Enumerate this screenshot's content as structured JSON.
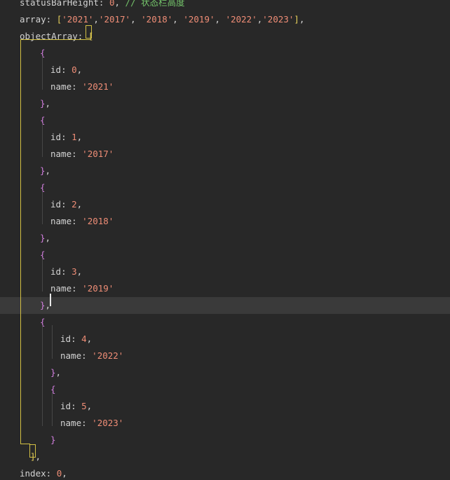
{
  "editor": {
    "lines": [
      {
        "indent": 28,
        "tokens": [
          {
            "t": "prop",
            "v": "statusBarHeight"
          },
          {
            "t": "punc",
            "v": ": "
          },
          {
            "t": "num",
            "v": "0"
          },
          {
            "t": "punc",
            "v": ", "
          },
          {
            "t": "cmt",
            "v": "// 状态栏高度"
          }
        ]
      },
      {
        "indent": 28,
        "tokens": [
          {
            "t": "prop",
            "v": "array"
          },
          {
            "t": "punc",
            "v": ": "
          },
          {
            "t": "brk",
            "v": "["
          },
          {
            "t": "str",
            "v": "'2021'"
          },
          {
            "t": "punc",
            "v": ","
          },
          {
            "t": "str",
            "v": "'2017'"
          },
          {
            "t": "punc",
            "v": ", "
          },
          {
            "t": "str",
            "v": "'2018'"
          },
          {
            "t": "punc",
            "v": ", "
          },
          {
            "t": "str",
            "v": "'2019'"
          },
          {
            "t": "punc",
            "v": ", "
          },
          {
            "t": "str",
            "v": "'2022'"
          },
          {
            "t": "punc",
            "v": ","
          },
          {
            "t": "str",
            "v": "'2023'"
          },
          {
            "t": "brk",
            "v": "]"
          },
          {
            "t": "punc",
            "v": ","
          }
        ]
      },
      {
        "indent": 28,
        "tokens": [
          {
            "t": "prop",
            "v": "objectArray"
          },
          {
            "t": "punc",
            "v": ": "
          },
          {
            "t": "brk",
            "v": "["
          }
        ]
      },
      {
        "indent": 57,
        "tokens": [
          {
            "t": "brace",
            "v": "{"
          }
        ]
      },
      {
        "indent": 72,
        "tokens": [
          {
            "t": "prop",
            "v": "id"
          },
          {
            "t": "punc",
            "v": ": "
          },
          {
            "t": "num",
            "v": "0"
          },
          {
            "t": "punc",
            "v": ","
          }
        ]
      },
      {
        "indent": 72,
        "tokens": [
          {
            "t": "prop",
            "v": "name"
          },
          {
            "t": "punc",
            "v": ": "
          },
          {
            "t": "str",
            "v": "'2021'"
          }
        ]
      },
      {
        "indent": 57,
        "tokens": [
          {
            "t": "brace",
            "v": "}"
          },
          {
            "t": "punc",
            "v": ","
          }
        ]
      },
      {
        "indent": 57,
        "tokens": [
          {
            "t": "brace",
            "v": "{"
          }
        ]
      },
      {
        "indent": 72,
        "tokens": [
          {
            "t": "prop",
            "v": "id"
          },
          {
            "t": "punc",
            "v": ": "
          },
          {
            "t": "num",
            "v": "1"
          },
          {
            "t": "punc",
            "v": ","
          }
        ]
      },
      {
        "indent": 72,
        "tokens": [
          {
            "t": "prop",
            "v": "name"
          },
          {
            "t": "punc",
            "v": ": "
          },
          {
            "t": "str",
            "v": "'2017'"
          }
        ]
      },
      {
        "indent": 57,
        "tokens": [
          {
            "t": "brace",
            "v": "}"
          },
          {
            "t": "punc",
            "v": ","
          }
        ]
      },
      {
        "indent": 57,
        "tokens": [
          {
            "t": "brace",
            "v": "{"
          }
        ]
      },
      {
        "indent": 72,
        "tokens": [
          {
            "t": "prop",
            "v": "id"
          },
          {
            "t": "punc",
            "v": ": "
          },
          {
            "t": "num",
            "v": "2"
          },
          {
            "t": "punc",
            "v": ","
          }
        ]
      },
      {
        "indent": 72,
        "tokens": [
          {
            "t": "prop",
            "v": "name"
          },
          {
            "t": "punc",
            "v": ": "
          },
          {
            "t": "str",
            "v": "'2018'"
          }
        ]
      },
      {
        "indent": 57,
        "tokens": [
          {
            "t": "brace",
            "v": "}"
          },
          {
            "t": "punc",
            "v": ","
          }
        ]
      },
      {
        "indent": 57,
        "tokens": [
          {
            "t": "brace",
            "v": "{"
          }
        ]
      },
      {
        "indent": 72,
        "tokens": [
          {
            "t": "prop",
            "v": "id"
          },
          {
            "t": "punc",
            "v": ": "
          },
          {
            "t": "num",
            "v": "3"
          },
          {
            "t": "punc",
            "v": ","
          }
        ]
      },
      {
        "indent": 72,
        "tokens": [
          {
            "t": "prop",
            "v": "name"
          },
          {
            "t": "punc",
            "v": ": "
          },
          {
            "t": "str",
            "v": "'2019'"
          }
        ]
      },
      {
        "indent": 57,
        "current": true,
        "tokens": [
          {
            "t": "brace",
            "v": "}"
          },
          {
            "t": "punc",
            "v": ","
          }
        ]
      },
      {
        "indent": 57,
        "tokens": [
          {
            "t": "brace",
            "v": "{"
          }
        ]
      },
      {
        "indent": 86,
        "tokens": [
          {
            "t": "prop",
            "v": "id"
          },
          {
            "t": "punc",
            "v": ": "
          },
          {
            "t": "num",
            "v": "4"
          },
          {
            "t": "punc",
            "v": ","
          }
        ]
      },
      {
        "indent": 86,
        "tokens": [
          {
            "t": "prop",
            "v": "name"
          },
          {
            "t": "punc",
            "v": ": "
          },
          {
            "t": "str",
            "v": "'2022'"
          }
        ]
      },
      {
        "indent": 72,
        "tokens": [
          {
            "t": "brace",
            "v": "}"
          },
          {
            "t": "punc",
            "v": ","
          }
        ]
      },
      {
        "indent": 72,
        "tokens": [
          {
            "t": "brace",
            "v": "{"
          }
        ]
      },
      {
        "indent": 86,
        "tokens": [
          {
            "t": "prop",
            "v": "id"
          },
          {
            "t": "punc",
            "v": ": "
          },
          {
            "t": "num",
            "v": "5"
          },
          {
            "t": "punc",
            "v": ","
          }
        ]
      },
      {
        "indent": 86,
        "tokens": [
          {
            "t": "prop",
            "v": "name"
          },
          {
            "t": "punc",
            "v": ": "
          },
          {
            "t": "str",
            "v": "'2023'"
          }
        ]
      },
      {
        "indent": 72,
        "tokens": [
          {
            "t": "brace",
            "v": "}"
          }
        ]
      },
      {
        "indent": 43,
        "tokens": [
          {
            "t": "brk",
            "v": "]"
          },
          {
            "t": "punc",
            "v": ","
          }
        ]
      },
      {
        "indent": 28,
        "tokens": [
          {
            "t": "prop",
            "v": "index"
          },
          {
            "t": "punc",
            "v": ": "
          },
          {
            "t": "num",
            "v": "0"
          },
          {
            "t": "punc",
            "v": ","
          }
        ]
      }
    ]
  }
}
